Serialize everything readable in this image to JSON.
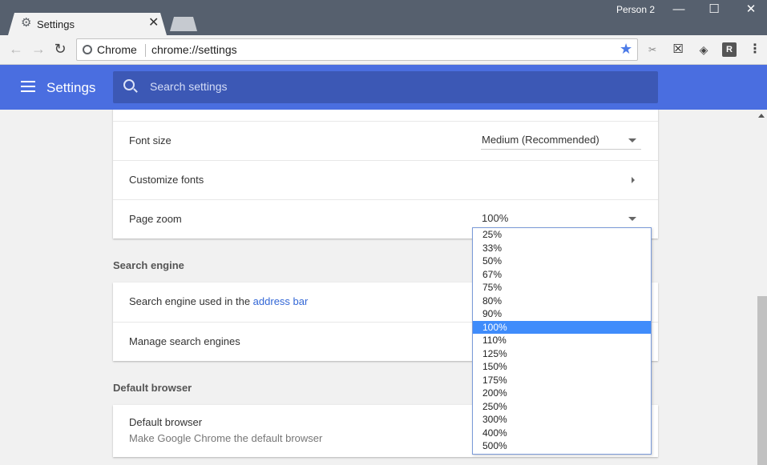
{
  "window": {
    "tab_title": "Settings",
    "tab_close": "✕",
    "profile_name": "Person 2",
    "minimize": "—",
    "maximize": "☐",
    "close": "✕"
  },
  "toolbar": {
    "back": "←",
    "forward": "→",
    "reload": "↻",
    "site_chip": "Chrome",
    "url": "chrome://settings",
    "bookmark_icon": "★",
    "extensions": [
      {
        "name": "scissors-icon",
        "glyph": "✂"
      },
      {
        "name": "window-x-icon",
        "glyph": "☒"
      },
      {
        "name": "ublock-icon",
        "glyph": "◈"
      },
      {
        "name": "r-extension-icon",
        "glyph": "R"
      }
    ],
    "menu_icon": "⋮"
  },
  "header": {
    "title": "Settings",
    "search_placeholder": "Search settings"
  },
  "appearance": {
    "font_size_label": "Font size",
    "font_size_value": "Medium (Recommended)",
    "customize_fonts_label": "Customize fonts",
    "page_zoom_label": "Page zoom",
    "page_zoom_value": "100%"
  },
  "search_engine": {
    "section_title": "Search engine",
    "used_label": "Search engine used in the ",
    "used_link": "address bar",
    "manage_label": "Manage search engines"
  },
  "default_browser": {
    "section_title": "Default browser",
    "title": "Default browser",
    "subtitle": "Make Google Chrome the default browser"
  },
  "zoom_dropdown": {
    "options": [
      "25%",
      "33%",
      "50%",
      "67%",
      "75%",
      "80%",
      "90%",
      "100%",
      "110%",
      "125%",
      "150%",
      "175%",
      "200%",
      "250%",
      "300%",
      "400%",
      "500%"
    ],
    "selected": "100%"
  },
  "colors": {
    "header": "#4a6ee0",
    "search_bg": "#3c58b5",
    "link": "#3367d6",
    "dropdown_selected": "#3f8cfb",
    "titlebar": "#56606e"
  }
}
